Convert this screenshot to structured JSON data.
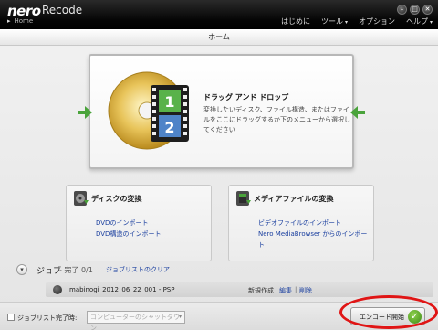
{
  "titlebar": {
    "logo": "nero",
    "app_name": "Recode",
    "breadcrumb": "Home",
    "window_buttons": [
      "minimize-icon",
      "restore-icon",
      "close-icon"
    ]
  },
  "menu": {
    "items": [
      {
        "label": "はじめに",
        "has_dropdown": false
      },
      {
        "label": "ツール",
        "has_dropdown": true
      },
      {
        "label": "オプション",
        "has_dropdown": false
      },
      {
        "label": "ヘルプ",
        "has_dropdown": true
      }
    ]
  },
  "header": {
    "title": "ホーム"
  },
  "dropzone": {
    "title": "ドラッグ アンド ドロップ",
    "description": "変換したいディスク、ファイル構造、またはファイルをここにドラッグするか下のメニューから選択してください",
    "film_numbers": [
      "1",
      "2"
    ],
    "accent_color": "#4aa33b"
  },
  "cards": {
    "disc": {
      "title": "ディスクの変換",
      "links": [
        "DVDのインポート",
        "DVD構造のインポート"
      ]
    },
    "media": {
      "title": "メディアファイルの変換",
      "links": [
        "ビデオファイルのインポート",
        "Nero MediaBrowser からのインポート"
      ]
    }
  },
  "jobs": {
    "label": "ジョブ",
    "status": "- 完了 0/1",
    "clear_link": "ジョブリストのクリア",
    "rows": [
      {
        "name": "mabinogi_2012_06_22_001 - PSP",
        "state": "新規作成",
        "edit": "編集",
        "separator": "|",
        "delete": "削除"
      }
    ]
  },
  "footer": {
    "after_job_label": "ジョブリスト完了時:",
    "after_job_checked": false,
    "after_job_select": "コンピューターのシャットダウン",
    "encode_button": "エンコード開始",
    "highlight_color": "#e01515"
  }
}
